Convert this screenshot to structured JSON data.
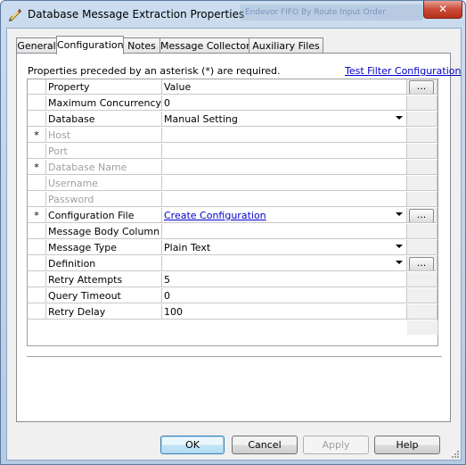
{
  "window": {
    "title": "Database Message Extraction Properties",
    "background_title_ghost": "Endevor FIFO By Route Input Order",
    "close_glyph": "✕"
  },
  "tabs": [
    {
      "label": "General"
    },
    {
      "label": "Configuration"
    },
    {
      "label": "Notes"
    },
    {
      "label": "Message Collector"
    },
    {
      "label": "Auxiliary Files"
    }
  ],
  "active_tab": "Configuration",
  "config": {
    "required_note": "Properties preceded by an asterisk (*) are required.",
    "test_filter_link": "Test Filter Configuration"
  },
  "grid": {
    "header": {
      "property": "Property",
      "value": "Value",
      "button": "..."
    },
    "rows": [
      {
        "marker": "",
        "property": "Maximum Concurrency",
        "value": "0",
        "dropdown": false,
        "ellipsis": false,
        "disabled": false,
        "link": false
      },
      {
        "marker": "",
        "property": "Database",
        "value": "Manual Setting",
        "dropdown": true,
        "ellipsis": false,
        "disabled": false,
        "link": false
      },
      {
        "marker": "*",
        "property": "Host",
        "value": "",
        "dropdown": false,
        "ellipsis": false,
        "disabled": true,
        "link": false
      },
      {
        "marker": "",
        "property": "Port",
        "value": "",
        "dropdown": false,
        "ellipsis": false,
        "disabled": true,
        "link": false
      },
      {
        "marker": "*",
        "property": "Database Name",
        "value": "",
        "dropdown": false,
        "ellipsis": false,
        "disabled": true,
        "link": false
      },
      {
        "marker": "",
        "property": "Username",
        "value": "",
        "dropdown": false,
        "ellipsis": false,
        "disabled": true,
        "link": false
      },
      {
        "marker": "",
        "property": "Password",
        "value": "",
        "dropdown": false,
        "ellipsis": false,
        "disabled": true,
        "link": false
      },
      {
        "marker": "*",
        "property": "Configuration File",
        "value": "Create Configuration",
        "dropdown": true,
        "ellipsis": true,
        "disabled": false,
        "link": true
      },
      {
        "marker": "",
        "property": "Message Body Column",
        "value": "",
        "dropdown": false,
        "ellipsis": false,
        "disabled": false,
        "link": false
      },
      {
        "marker": "",
        "property": "Message Type",
        "value": "Plain Text",
        "dropdown": true,
        "ellipsis": false,
        "disabled": false,
        "link": false
      },
      {
        "marker": "",
        "property": "Definition",
        "value": "",
        "dropdown": true,
        "ellipsis": true,
        "disabled": false,
        "link": false
      },
      {
        "marker": "",
        "property": "Retry Attempts",
        "value": "5",
        "dropdown": false,
        "ellipsis": false,
        "disabled": false,
        "link": false
      },
      {
        "marker": "",
        "property": "Query Timeout",
        "value": "0",
        "dropdown": false,
        "ellipsis": false,
        "disabled": false,
        "link": false
      },
      {
        "marker": "",
        "property": "Retry Delay",
        "value": "100",
        "dropdown": false,
        "ellipsis": false,
        "disabled": false,
        "link": false
      }
    ]
  },
  "buttons": {
    "ok": "OK",
    "cancel": "Cancel",
    "apply": "Apply",
    "help": "Help"
  },
  "colors": {
    "link": "#0000cc",
    "disabled_text": "#a0a0a0",
    "close_button": "#c94b37"
  }
}
